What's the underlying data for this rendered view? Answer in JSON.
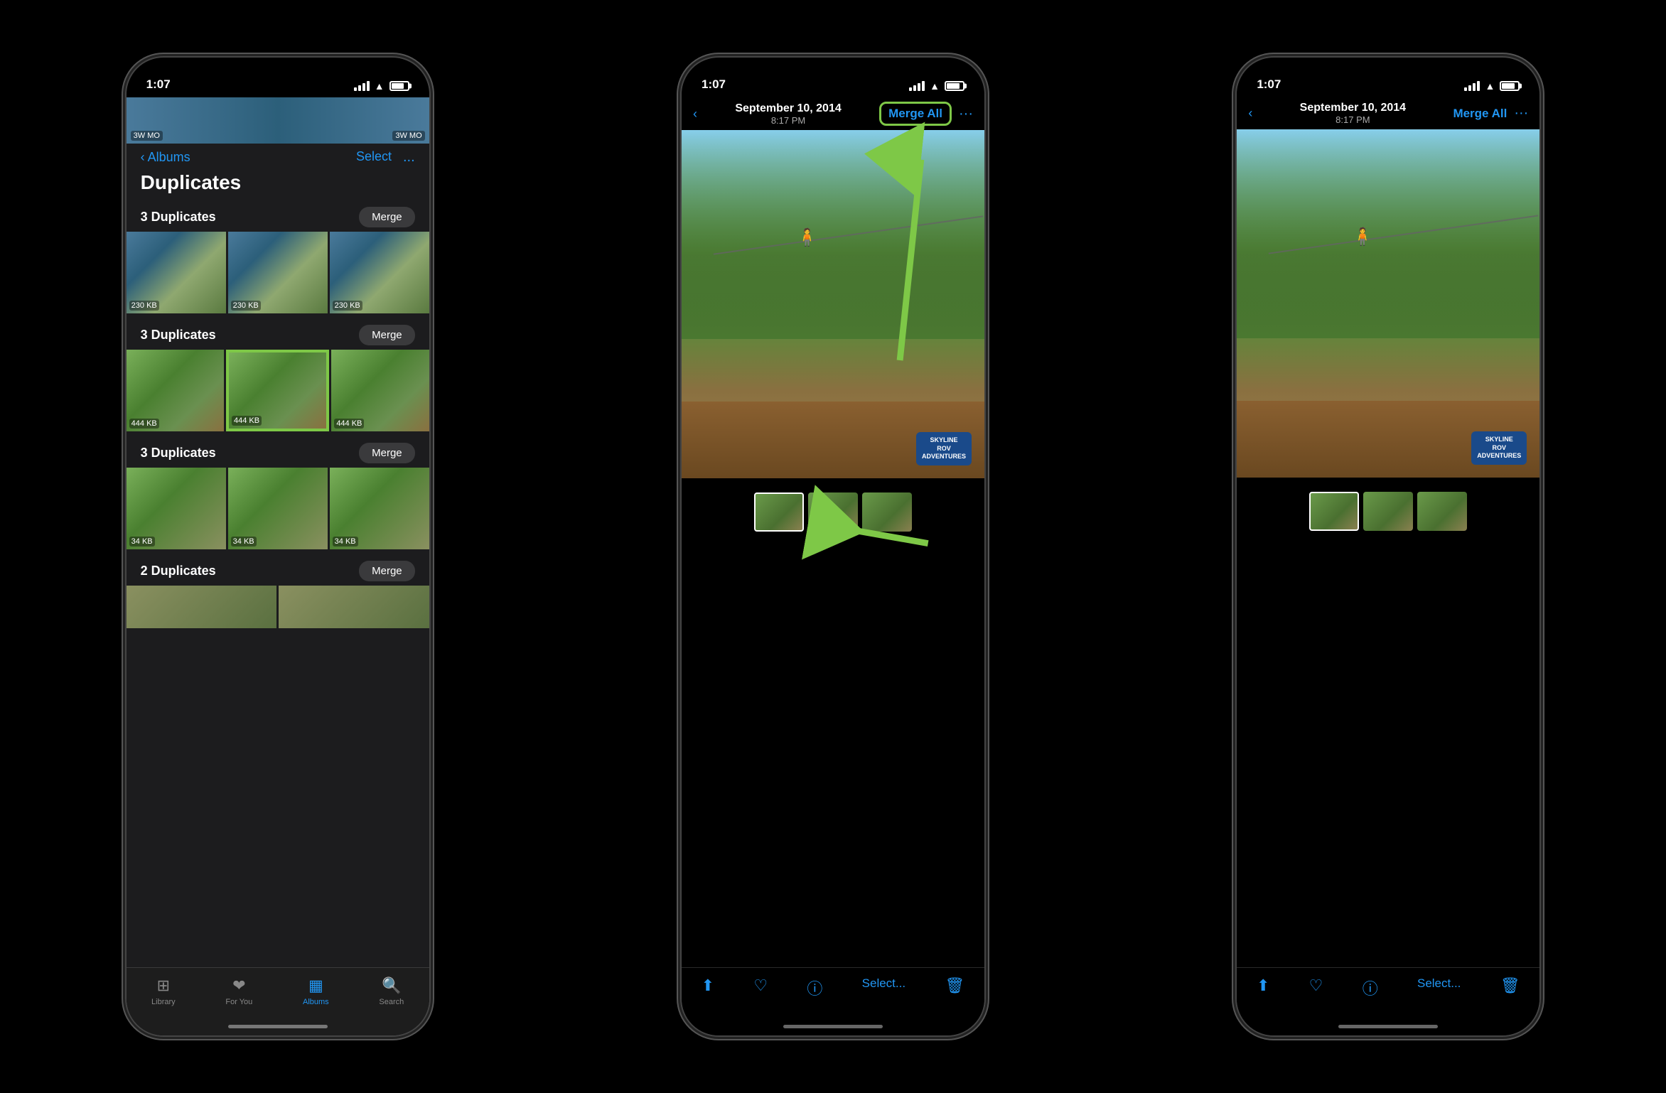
{
  "phones": [
    {
      "id": "phone1",
      "statusBar": {
        "time": "1:07",
        "signal": true,
        "wifi": true,
        "battery": true
      },
      "navBar": {
        "backLabel": "Albums",
        "title": "Duplicates",
        "selectLabel": "Select",
        "moreLabel": "..."
      },
      "groups": [
        {
          "label": "3 Duplicates",
          "mergeLabel": "Merge",
          "photos": [
            {
              "size": "230 KB",
              "colorClass": "g1p1"
            },
            {
              "size": "230 KB",
              "colorClass": "g1p2"
            },
            {
              "size": "230 KB",
              "colorClass": "g1p3"
            }
          ]
        },
        {
          "label": "3 Duplicates",
          "mergeLabel": "Merge",
          "highlighted": true,
          "photos": [
            {
              "size": "444 KB",
              "colorClass": "g2p1"
            },
            {
              "size": "444 KB",
              "colorClass": "g2p2",
              "highlighted": true
            },
            {
              "size": "444 KB",
              "colorClass": "g2p3"
            }
          ]
        },
        {
          "label": "3 Duplicates",
          "mergeLabel": "Merge",
          "photos": [
            {
              "size": "34 KB",
              "colorClass": "g3p1"
            },
            {
              "size": "34 KB",
              "colorClass": "g3p2"
            },
            {
              "size": "34 KB",
              "colorClass": "g3p3"
            }
          ]
        },
        {
          "label": "2 Duplicates",
          "mergeLabel": "Merge",
          "photos": [
            {
              "size": "",
              "colorClass": "g4p1"
            }
          ]
        }
      ],
      "tabBar": {
        "items": [
          {
            "label": "Library",
            "icon": "📷",
            "active": false
          },
          {
            "label": "For You",
            "icon": "❤️",
            "active": false
          },
          {
            "label": "Albums",
            "icon": "🖼",
            "active": true
          },
          {
            "label": "Search",
            "icon": "🔍",
            "active": false
          }
        ]
      }
    },
    {
      "id": "phone2",
      "statusBar": {
        "time": "1:07"
      },
      "navBar": {
        "backLabel": "‹",
        "date": "September 10, 2014",
        "time": "8:17 PM",
        "mergeAllLabel": "Merge All",
        "mergeAllHighlighted": true,
        "moreLabel": "···"
      },
      "mainPhoto": {
        "description": "Zipline adventure photo"
      },
      "stripPhotos": 3,
      "toolbar": {
        "share": "↑",
        "heart": "♡",
        "info": "ⓘ",
        "select": "Select...",
        "delete": "🗑"
      },
      "hasArrows": true
    },
    {
      "id": "phone3",
      "statusBar": {
        "time": "1:07"
      },
      "navBar": {
        "backLabel": "‹",
        "date": "September 10, 2014",
        "time": "8:17 PM",
        "mergeAllLabel": "Merge All",
        "mergeAllHighlighted": false,
        "moreLabel": "···"
      },
      "mainPhoto": {
        "description": "Zipline adventure photo after merge"
      },
      "stripPhotos": 3,
      "toolbar": {
        "share": "↑",
        "heart": "♡",
        "info": "ⓘ",
        "select": "Select...",
        "delete": "🗑"
      },
      "hasArrows": false
    }
  ]
}
